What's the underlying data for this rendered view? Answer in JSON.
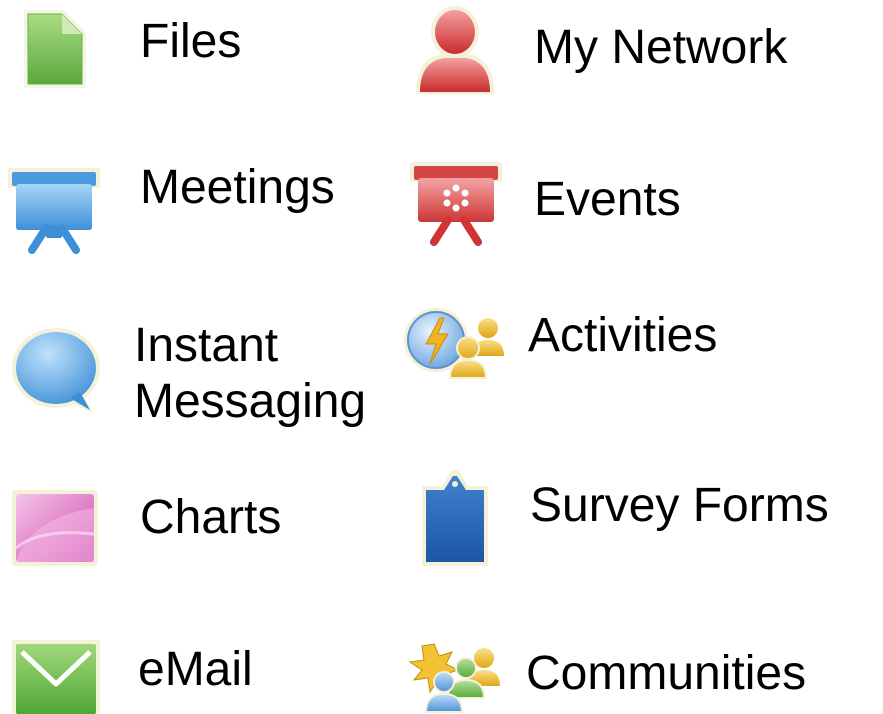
{
  "left_column": [
    {
      "key": "files",
      "label": "Files",
      "icon": "document-icon"
    },
    {
      "key": "meetings",
      "label": "Meetings",
      "icon": "presentation-board-icon"
    },
    {
      "key": "instant_messaging",
      "label_line1": "Instant",
      "label_line2": "Messaging",
      "icon": "speech-bubble-icon"
    },
    {
      "key": "charts",
      "label": "Charts",
      "icon": "chart-tile-icon"
    },
    {
      "key": "email",
      "label": "eMail",
      "icon": "envelope-icon"
    }
  ],
  "right_column": [
    {
      "key": "my_network",
      "label": "My Network",
      "icon": "person-icon"
    },
    {
      "key": "events",
      "label": "Events",
      "icon": "event-board-icon"
    },
    {
      "key": "activities",
      "label": "Activities",
      "icon": "activities-people-icon"
    },
    {
      "key": "survey_forms",
      "label": "Survey Forms",
      "icon": "clipboard-tag-icon"
    },
    {
      "key": "communities",
      "label": "Communities",
      "icon": "community-people-icon"
    }
  ],
  "colors": {
    "files": "#79c158",
    "meetings": "#5aa8e6",
    "instant_messaging": "#5aa8e6",
    "charts": "#d65db4",
    "email": "#62b945",
    "my_network": "#d93a3a",
    "events": "#d94040",
    "activities_bolt": "#f2b320",
    "survey_forms": "#2a67ba",
    "communities_star": "#f1c232"
  }
}
